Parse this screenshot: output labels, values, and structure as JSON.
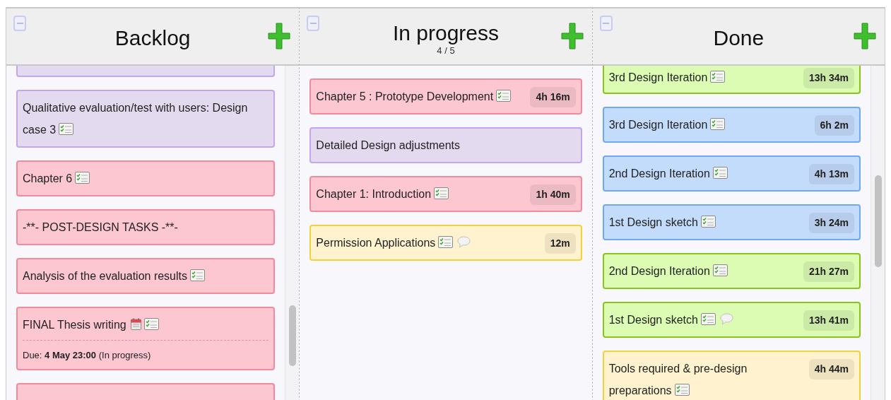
{
  "columns": [
    {
      "title": "Backlog",
      "cards": [
        {
          "kind": "cut_off",
          "color": "#e4daf0"
        },
        {
          "kind": "card",
          "color": "#e4daf0",
          "title": "Qualitative evaluation/test with users: Design case 3",
          "checklist": true
        },
        {
          "kind": "card",
          "color": "#fcc7d1",
          "title": "Chapter 6",
          "checklist": true
        },
        {
          "kind": "card",
          "color": "#fcc7d1",
          "title": "-**- POST-DESIGN TASKS -**-"
        },
        {
          "kind": "card",
          "color": "#fcc7d1",
          "title": "Analysis of the evaluation results",
          "checklist": true
        },
        {
          "kind": "card",
          "color": "#fcc7d1",
          "title": "FINAL Thesis writing",
          "calendar": true,
          "checklist": true,
          "due": "Due: **4 May 23:00** (In progress)"
        },
        {
          "kind": "cut_off",
          "color": "#fcc7d1"
        }
      ]
    },
    {
      "title": "In progress",
      "count": "4 / 5",
      "cards": [
        {
          "kind": "card",
          "color": "#fcc7d1",
          "title": "Chapter 5 : Prototype Development",
          "checklist": true,
          "time": "4h 16m"
        },
        {
          "kind": "card",
          "color": "#e4daf0",
          "title": "Detailed Design adjustments"
        },
        {
          "kind": "card",
          "color": "#fcc7d1",
          "title": "Chapter 1: Introduction",
          "checklist": true,
          "time": "1h 40m"
        },
        {
          "kind": "card",
          "color": "#fff3cf",
          "title": "Permission Applications",
          "checklist": true,
          "comment": true,
          "time": "12m"
        }
      ]
    },
    {
      "title": "Done",
      "cards": [
        {
          "kind": "cut_top",
          "color": "#dcfcb4",
          "title": "3rd Design Iteration",
          "checklist": true,
          "time": "13h 34m"
        },
        {
          "kind": "card",
          "color": "#c4dcfc",
          "title": "3rd Design Iteration",
          "checklist": true,
          "time": "6h 2m"
        },
        {
          "kind": "card",
          "color": "#c4dcfc",
          "title": "2nd Design Iteration",
          "checklist": true,
          "time": "4h 13m"
        },
        {
          "kind": "card",
          "color": "#c4dcfc",
          "title": "1st Design sketch",
          "checklist": true,
          "time": "3h 24m"
        },
        {
          "kind": "card",
          "color": "#dcfcb4",
          "title": "2nd Design Iteration",
          "checklist": true,
          "time": "21h 27m"
        },
        {
          "kind": "card",
          "color": "#dcfcb4",
          "title": "1st Design sketch",
          "checklist": true,
          "comment": true,
          "time": "13h 41m"
        },
        {
          "kind": "card",
          "color": "#fff3cf",
          "title": "Tools required & pre-design preparations",
          "checklist": true,
          "time": "4h 44m"
        }
      ]
    }
  ]
}
